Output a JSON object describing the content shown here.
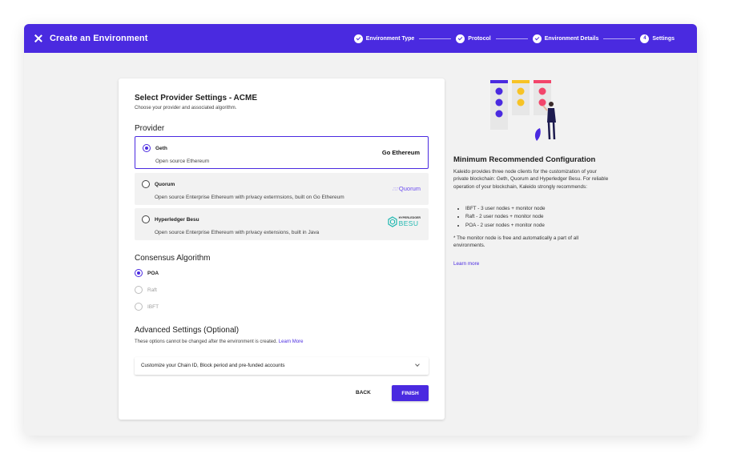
{
  "header": {
    "title": "Create an Environment",
    "steps": [
      {
        "label": "Environment Type",
        "state": "done"
      },
      {
        "label": "Protocol",
        "state": "done"
      },
      {
        "label": "Environment Details",
        "state": "done"
      },
      {
        "label": "Settings",
        "number": "4",
        "state": "current"
      }
    ]
  },
  "card": {
    "title": "Select Provider Settings - ACME",
    "subtitle": "Choose your provider and associated algorithm.",
    "provider_heading": "Provider",
    "providers": [
      {
        "name": "Geth",
        "description": "Open source Ethereum",
        "logo": "Go Ethereum",
        "selected": true
      },
      {
        "name": "Quorum",
        "description": "Open source Enterprise Ethereum with privacy exterrnsions, built on Go Ethereum",
        "logo": "Quorum",
        "selected": false
      },
      {
        "name": "Hyperledger Besu",
        "description": "Open source Enterprise Ethereum with privacy extensions, built in Java",
        "logo_top": "HYPERLEDGER",
        "logo_bottom": "BESU",
        "selected": false
      }
    ],
    "consensus_heading": "Consensus Algorithm",
    "consensus": [
      {
        "label": "POA",
        "selected": true,
        "disabled": false
      },
      {
        "label": "Raft",
        "selected": false,
        "disabled": true
      },
      {
        "label": "IBFT",
        "selected": false,
        "disabled": true
      }
    ],
    "advanced_heading": "Advanced Settings (Optional)",
    "advanced_text": "These options cannot be changed after the environment is created.",
    "advanced_link": "Learn More",
    "accordion_label": "Customize your Chain ID, Block period and pre-funded accounts",
    "back_label": "BACK",
    "finish_label": "FINISH"
  },
  "side": {
    "title": "Minimum Recommended Configuration",
    "body": "Kaleido provides three node clients for the customization of your private blockchain: Geth, Quorum and Hyperledger Besu. For reliable operation of your blockchain, Kaleido strongly recommends:",
    "items": [
      "IBFT - 3 user nodes + monitor node",
      "Raft - 2 user nodes + monitor node",
      "POA - 2 user nodes + monitor node"
    ],
    "note": "* The monitor node is free and automatically a part of all environments.",
    "link": "Learn more"
  },
  "colors": {
    "accent": "#4a2ae0",
    "yellow": "#f7c326",
    "pink": "#f2456b"
  }
}
